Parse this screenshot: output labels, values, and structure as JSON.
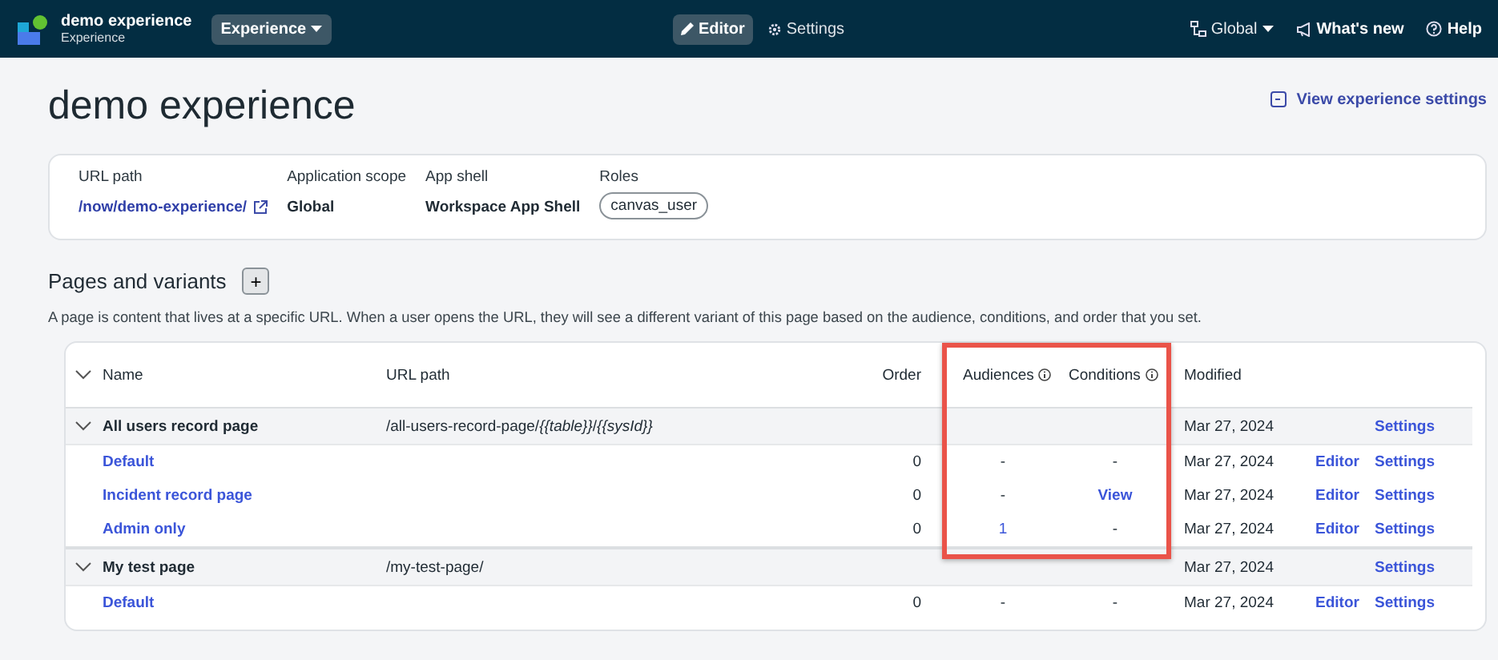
{
  "app_bar": {
    "app_name": "demo experience",
    "app_type": "Experience",
    "menu_button": "Experience",
    "tabs": [
      {
        "label": "Editor",
        "kind": "editor",
        "selected": true
      },
      {
        "label": "Settings",
        "kind": "settings",
        "selected": false
      }
    ],
    "scope_menu": "Global",
    "whats_new": "What's new",
    "help": "Help"
  },
  "title": "demo experience",
  "view_settings_link": "View experience settings",
  "info": [
    {
      "label": "URL path",
      "value": "/now/demo-experience/",
      "kind": "link"
    },
    {
      "label": "Application scope",
      "value": "Global",
      "kind": "text"
    },
    {
      "label": "App shell",
      "value": "Workspace App Shell",
      "kind": "text"
    },
    {
      "label": "Roles",
      "value": "canvas_user",
      "kind": "chip"
    }
  ],
  "pages_section": {
    "heading": "Pages and variants",
    "add_button": "+",
    "description": "A page is content that lives at a specific URL. When a user opens the URL, they will see a different variant of this page based on the audience, conditions, and order that you set."
  },
  "table": {
    "columns": [
      "Name",
      "URL path",
      "Order",
      "Audiences",
      "Conditions",
      "Modified"
    ],
    "pages": [
      {
        "name": "All users record page",
        "url_path": "/all-users-record-page/*{{table}}*/*{{sysId}}*",
        "modified": "Mar 27, 2024",
        "settings": "Settings",
        "expanded": true,
        "variants": [
          {
            "name": "Default",
            "order": "0",
            "audiences": {
              "text": "-",
              "link": false
            },
            "conditions": {
              "text": "-",
              "link": false
            },
            "modified": "Mar 27, 2024",
            "editor": "Editor",
            "settings": "Settings"
          },
          {
            "name": "Incident record page",
            "order": "0",
            "audiences": {
              "text": "-",
              "link": false
            },
            "conditions": {
              "text": "View",
              "link": true
            },
            "modified": "Mar 27, 2024",
            "editor": "Editor",
            "settings": "Settings"
          },
          {
            "name": "Admin only",
            "order": "0",
            "audiences": {
              "text": "1",
              "link": true
            },
            "conditions": {
              "text": "-",
              "link": false
            },
            "modified": "Mar 27, 2024",
            "editor": "Editor",
            "settings": "Settings"
          }
        ]
      },
      {
        "name": "My test page",
        "url_path": "/my-test-page/",
        "modified": "Mar 27, 2024",
        "settings": "Settings",
        "expanded": true,
        "variants": [
          {
            "name": "Default",
            "order": "0",
            "audiences": {
              "text": "-",
              "link": false
            },
            "conditions": {
              "text": "-",
              "link": false
            },
            "modified": "Mar 27, 2024",
            "editor": "Editor",
            "settings": "Settings"
          }
        ]
      }
    ]
  }
}
